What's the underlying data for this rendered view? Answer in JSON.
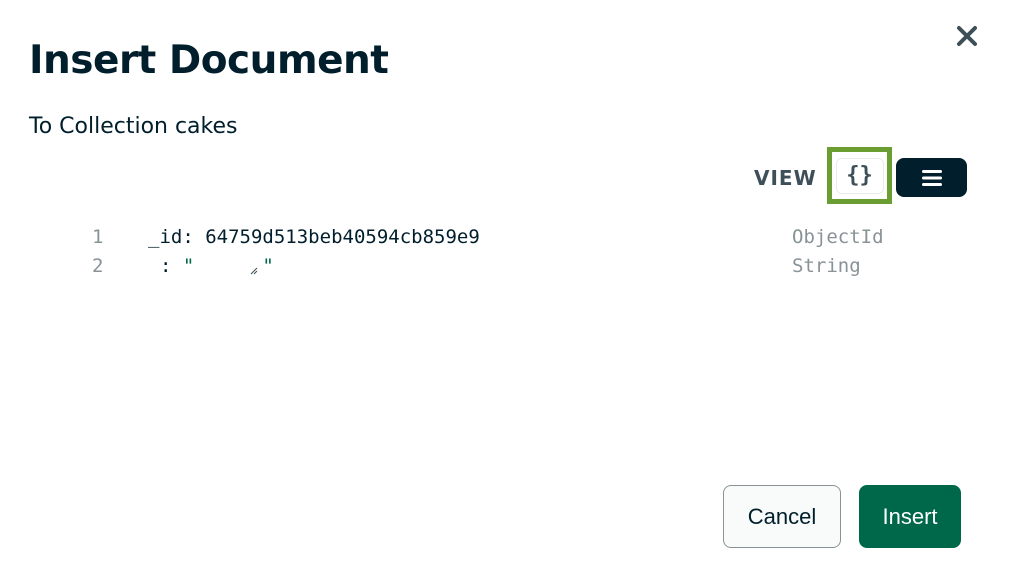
{
  "dialog": {
    "title": "Insert Document",
    "subtitle": "To Collection cakes",
    "close_icon": "close-icon"
  },
  "view": {
    "label": "VIEW",
    "json_icon_text": "{}",
    "json_icon": "curly-braces-icon",
    "list_icon": "list-icon",
    "selected": "json"
  },
  "document": {
    "lines": [
      {
        "number": "1",
        "key": "_id",
        "separator": ":",
        "value": "64759d513beb40594cb859e9",
        "type": "ObjectId"
      },
      {
        "number": "2",
        "key": "",
        "separator": ":",
        "value": "",
        "open_quote": "\"",
        "close_quote": "\"",
        "type": "String"
      }
    ]
  },
  "buttons": {
    "cancel": "Cancel",
    "insert": "Insert"
  },
  "colors": {
    "primary": "#00684a",
    "dark": "#001e2b",
    "highlight": "#6a9e33",
    "muted": "#889397"
  }
}
